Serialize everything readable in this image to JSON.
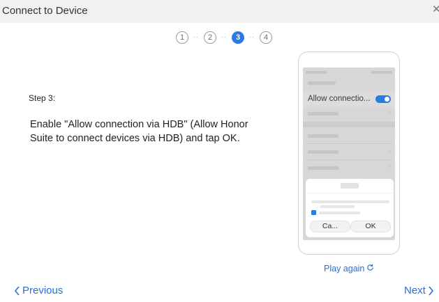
{
  "window": {
    "title": "Connect to Device"
  },
  "stepper": {
    "steps": [
      "1",
      "2",
      "3",
      "4"
    ],
    "active_index": 2
  },
  "step_label": "Step 3:",
  "instruction": "Enable \"Allow connection via HDB\" (Allow Honor Suite to connect devices via HDB) and tap OK.",
  "phone": {
    "allow_label": "Allow connectio...",
    "dialog": {
      "cancel_label": "Ca...",
      "ok_label": "OK"
    }
  },
  "play_again_label": "Play again",
  "nav": {
    "previous_label": "Previous",
    "next_label": "Next"
  },
  "colors": {
    "accent": "#2a7be4",
    "link": "#2a6fd6",
    "titlebar": "#f1f1f1"
  },
  "icons": [
    "close-icon",
    "chevron-left-icon",
    "chevron-right-icon",
    "refresh-icon"
  ]
}
